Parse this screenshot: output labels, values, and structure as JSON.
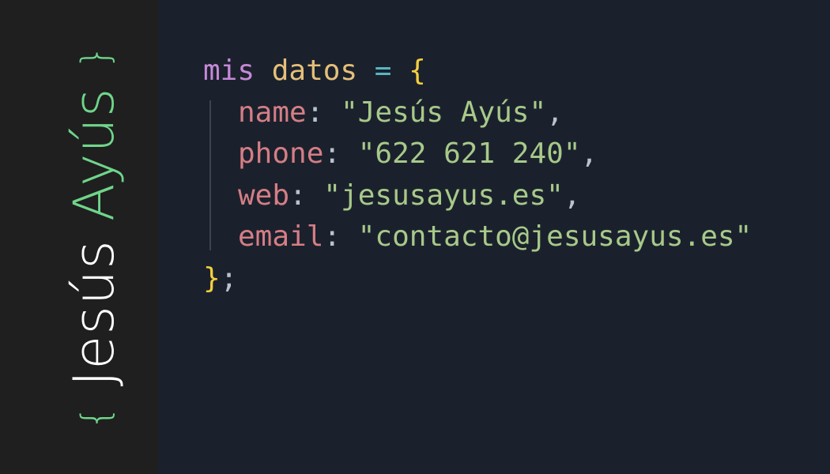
{
  "logo": {
    "open_brace": "{",
    "first_name": "Jesús",
    "last_name": "Ayús",
    "close_brace": "}"
  },
  "code": {
    "keyword": "mis",
    "variable": "datos",
    "operator": "=",
    "open_brace": "{",
    "fields": [
      {
        "key": "name",
        "value": "\"Jesús Ayús\"",
        "trail": ","
      },
      {
        "key": "phone",
        "value": "\"622 621 240\"",
        "trail": ","
      },
      {
        "key": "web",
        "value": "\"jesusayus.es\"",
        "trail": ","
      },
      {
        "key": "email",
        "value": "\"contacto@jesusayus.es\"",
        "trail": ""
      }
    ],
    "close_brace": "}",
    "terminator": ";"
  },
  "colors": {
    "background": "#1b212c",
    "sidebar": "#1f1f1f",
    "logo_accent": "#6fd58a",
    "keyword": "#c689d8",
    "variable": "#e5c07b",
    "key": "#d57e86",
    "string": "#a7c98a"
  }
}
